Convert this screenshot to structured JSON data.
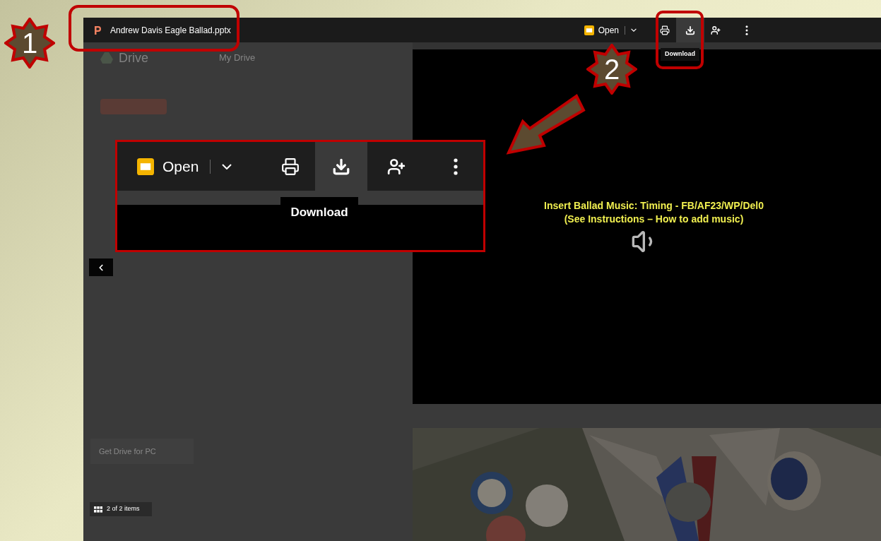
{
  "steps": [
    {
      "number": "1"
    },
    {
      "number": "2"
    }
  ],
  "viewer": {
    "file_name": "Andrew Davis Eagle Ballad.pptx",
    "toolbar": [
      {
        "kind": "open",
        "label": "Open",
        "selected": false
      },
      {
        "kind": "print",
        "selected": false
      },
      {
        "kind": "download",
        "selected": true
      },
      {
        "kind": "share",
        "selected": false
      },
      {
        "kind": "more",
        "selected": false
      }
    ],
    "tooltip": "Download",
    "background": {
      "app_name": "Drive",
      "location": "My Drive",
      "promo": "Get Drive for PC"
    },
    "item_count": "2 of 2 items",
    "slide": {
      "lines": [
        "Insert Ballad Music:  Timing - FB/AF23/WP/Del0",
        "(See Instructions – How to add music)"
      ]
    }
  },
  "inset": {
    "toolbar": [
      {
        "kind": "open",
        "label": "Open",
        "selected": false
      },
      {
        "kind": "print",
        "selected": false
      },
      {
        "kind": "download",
        "selected": true
      },
      {
        "kind": "share",
        "selected": false
      },
      {
        "kind": "more",
        "selected": false
      }
    ],
    "tooltip": "Download"
  }
}
